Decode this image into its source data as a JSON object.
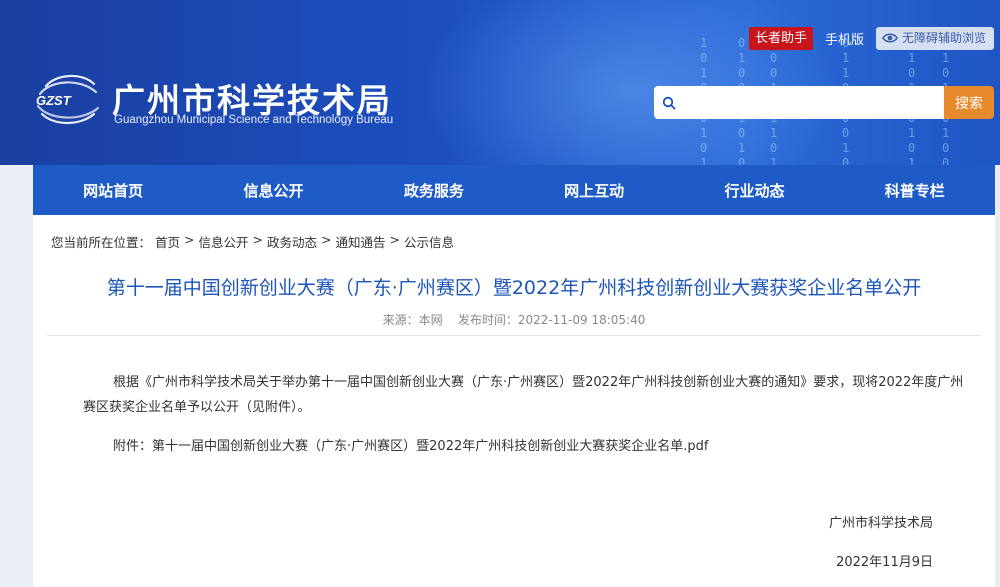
{
  "header": {
    "logo_text": "GZST",
    "title_cn": "广州市科学技术局",
    "title_en": "Guangzhou Municipal Science and Technology Bureau",
    "elder_mode": "长者助手",
    "mobile": "手机版",
    "accessibility": "无障碍辅助浏览",
    "search_placeholder": "",
    "search_button": "搜索",
    "icons": {
      "search": "search-icon",
      "accessibility": "eye-icon",
      "logo": "gzst-logo"
    }
  },
  "nav": [
    {
      "label": "网站首页"
    },
    {
      "label": "信息公开"
    },
    {
      "label": "政务服务"
    },
    {
      "label": "网上互动"
    },
    {
      "label": "行业动态"
    },
    {
      "label": "科普专栏"
    }
  ],
  "breadcrumb": {
    "prefix": "您当前所在位置：",
    "items": [
      "首页",
      "信息公开",
      "政务动态",
      "通知通告",
      "公示信息"
    ],
    "sep": ">"
  },
  "article": {
    "title": "第十一届中国创新创业大赛（广东·广州赛区）暨2022年广州科技创新创业大赛获奖企业名单公开",
    "source": "来源：本网",
    "published": "发布时间：2022-11-09 18:05:40",
    "body": "根据《广州市科学技术局关于举办第十一届中国创新创业大赛（广东·广州赛区）暨2022年广州科技创新创业大赛的通知》要求，现将2022年度广州赛区获奖企业名单予以公开（见附件）。",
    "attachment_label": "附件：",
    "attachment_name": "第十一届中国创新创业大赛（广东·广州赛区）暨2022年广州科技创新创业大赛获奖企业名单.pdf",
    "signature_org": "广州市科学技术局",
    "signature_date": "2022年11月9日"
  },
  "colors": {
    "header_blue": "#1d4fc0",
    "nav_blue": "#1e5bc6",
    "title_blue": "#1d56b8",
    "search_orange": "#e8892b",
    "elder_red": "#c8151b"
  }
}
